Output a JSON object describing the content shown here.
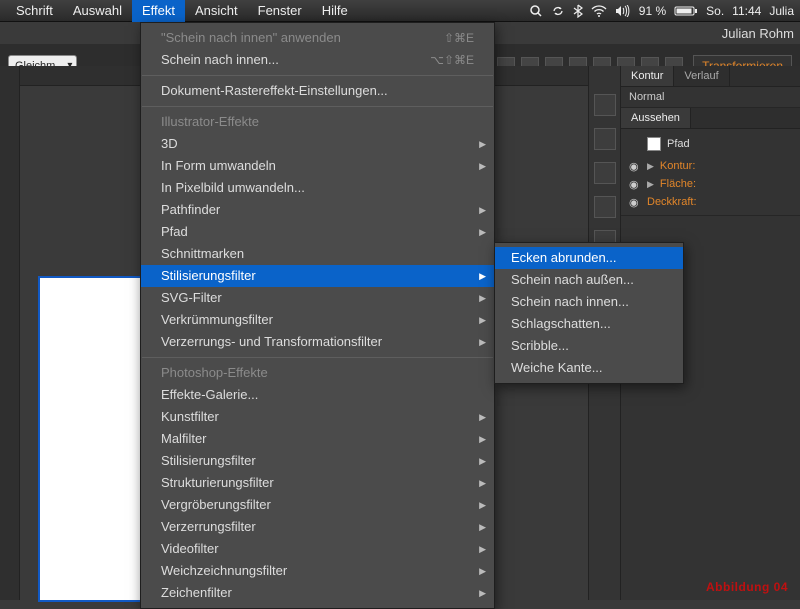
{
  "menubar": {
    "items": [
      "Schrift",
      "Auswahl",
      "Effekt",
      "Ansicht",
      "Fenster",
      "Hilfe"
    ],
    "selected_index": 2,
    "status": {
      "battery_pct": "91 %",
      "day": "So.",
      "time": "11:44",
      "user": "Julia"
    }
  },
  "user_label": "Julian Rohm",
  "toolbar": {
    "profile": "Gleichm.",
    "transform_btn": "Transformieren"
  },
  "effect_menu": {
    "apply": {
      "label": "\"Schein nach innen\" anwenden",
      "shortcut": "⇧⌘E"
    },
    "apply_last": {
      "label": "Schein nach innen...",
      "shortcut": "⌥⇧⌘E"
    },
    "raster": "Dokument-Rastereffekt-Einstellungen...",
    "heading1": "Illustrator-Effekte",
    "group1": [
      {
        "label": "3D",
        "sub": true
      },
      {
        "label": "In Form umwandeln",
        "sub": true
      },
      {
        "label": "In Pixelbild umwandeln...",
        "sub": false
      },
      {
        "label": "Pathfinder",
        "sub": true
      },
      {
        "label": "Pfad",
        "sub": true
      },
      {
        "label": "Schnittmarken",
        "sub": false
      },
      {
        "label": "Stilisierungsfilter",
        "sub": true,
        "highlight": true
      },
      {
        "label": "SVG-Filter",
        "sub": true
      },
      {
        "label": "Verkrümmungsfilter",
        "sub": true
      },
      {
        "label": "Verzerrungs- und Transformationsfilter",
        "sub": true
      }
    ],
    "heading2": "Photoshop-Effekte",
    "group2": [
      {
        "label": "Effekte-Galerie...",
        "sub": false
      },
      {
        "label": "Kunstfilter",
        "sub": true
      },
      {
        "label": "Malfilter",
        "sub": true
      },
      {
        "label": "Stilisierungsfilter",
        "sub": true
      },
      {
        "label": "Strukturierungsfilter",
        "sub": true
      },
      {
        "label": "Vergröberungsfilter",
        "sub": true
      },
      {
        "label": "Verzerrungsfilter",
        "sub": true
      },
      {
        "label": "Videofilter",
        "sub": true
      },
      {
        "label": "Weichzeichnungsfilter",
        "sub": true
      },
      {
        "label": "Zeichenfilter",
        "sub": true
      }
    ]
  },
  "submenu": {
    "items": [
      {
        "label": "Ecken abrunden...",
        "highlight": true
      },
      {
        "label": "Schein nach außen..."
      },
      {
        "label": "Schein nach innen..."
      },
      {
        "label": "Schlagschatten..."
      },
      {
        "label": "Scribble..."
      },
      {
        "label": "Weiche Kante..."
      }
    ]
  },
  "rpanel": {
    "tabs": [
      "Kontur",
      "Verlauf"
    ],
    "blend": "Normal",
    "section": "Aussehen",
    "pfad": "Pfad",
    "rows": [
      "Kontur:",
      "Fläche:",
      "Deckkraft:"
    ]
  },
  "footer": "Abbildung 04"
}
